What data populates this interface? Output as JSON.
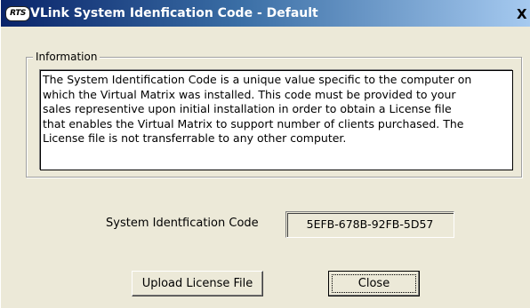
{
  "window": {
    "title": "VLink System Idenfication Code - Default",
    "app_icon_text": "RTS",
    "close_symbol": "X"
  },
  "information": {
    "group_label": "Information",
    "text": "The System Identification Code is a unique value specific to the computer on\nwhich the Virtual Matrix was installed.  This code must be provided to your\nsales representive upon initial installation in order to obtain a License file\nthat enables the Virtual Matrix to support number of clients purchased.  The\nLicense file is not transferrable to any other computer."
  },
  "system_code": {
    "label": "System Identfication Code",
    "value": "5EFB-678B-92FB-5D57"
  },
  "buttons": {
    "upload_label": "Upload License File",
    "close_label": "Close"
  },
  "colors": {
    "titlebar_start": "#0a246a",
    "titlebar_end": "#a6caf0",
    "dialog_background": "#ece9d8"
  },
  "icons": {
    "app_icon": "rts-logo-icon",
    "close_icon": "close-icon"
  }
}
